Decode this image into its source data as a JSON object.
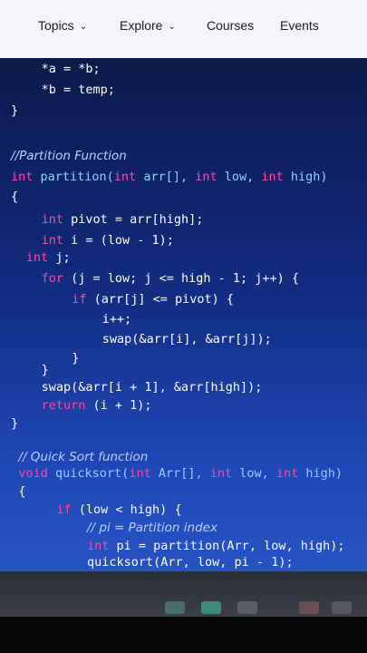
{
  "nav": {
    "items": [
      {
        "label": "Topics",
        "has_dropdown": true
      },
      {
        "label": "Explore",
        "has_dropdown": true
      },
      {
        "label": "Courses",
        "has_dropdown": false
      },
      {
        "label": "Events",
        "has_dropdown": false
      }
    ]
  },
  "code": {
    "lines": [
      {
        "indent": 4,
        "tokens": [
          {
            "t": "*a = *b;",
            "c": "pl"
          }
        ]
      },
      {
        "indent": 4,
        "tokens": [
          {
            "t": "*b = temp;",
            "c": "pl"
          }
        ]
      },
      {
        "indent": 0,
        "tokens": [
          {
            "t": "}",
            "c": "pl"
          }
        ]
      },
      {
        "indent": 0,
        "tokens": []
      },
      {
        "indent": 0,
        "tokens": [
          {
            "t": "//Partition Function",
            "c": "cm"
          }
        ]
      },
      {
        "indent": 0,
        "tokens": [
          {
            "t": "int ",
            "c": "kw"
          },
          {
            "t": "partition(",
            "c": "fn"
          },
          {
            "t": "int ",
            "c": "kw"
          },
          {
            "t": "arr[], ",
            "c": "fn"
          },
          {
            "t": "int ",
            "c": "kw"
          },
          {
            "t": "low, ",
            "c": "fn"
          },
          {
            "t": "int ",
            "c": "kw"
          },
          {
            "t": "high)",
            "c": "fn"
          }
        ]
      },
      {
        "indent": 0,
        "tokens": [
          {
            "t": "{",
            "c": "pl"
          }
        ]
      },
      {
        "indent": 4,
        "tokens": [
          {
            "t": "int ",
            "c": "kw"
          },
          {
            "t": "pivot = arr[high];",
            "c": "pl"
          }
        ]
      },
      {
        "indent": 4,
        "tokens": [
          {
            "t": "int ",
            "c": "kw"
          },
          {
            "t": "i = (low - 1);",
            "c": "pl"
          }
        ]
      },
      {
        "indent": 2,
        "tokens": [
          {
            "t": "int ",
            "c": "kw"
          },
          {
            "t": "j;",
            "c": "pl"
          }
        ]
      },
      {
        "indent": 4,
        "tokens": [
          {
            "t": "for ",
            "c": "kw"
          },
          {
            "t": "(j = low; j <= high - 1; j++) {",
            "c": "pl"
          }
        ]
      },
      {
        "indent": 8,
        "tokens": [
          {
            "t": "if ",
            "c": "kw"
          },
          {
            "t": "(arr[j] <= pivot) {",
            "c": "pl"
          }
        ]
      },
      {
        "indent": 12,
        "tokens": [
          {
            "t": "i++;",
            "c": "pl"
          }
        ]
      },
      {
        "indent": 12,
        "tokens": [
          {
            "t": "swap(&arr[i], &arr[j]);",
            "c": "pl"
          }
        ]
      },
      {
        "indent": 8,
        "tokens": [
          {
            "t": "}",
            "c": "pl"
          }
        ]
      },
      {
        "indent": 4,
        "tokens": [
          {
            "t": "}",
            "c": "pl"
          }
        ]
      },
      {
        "indent": 4,
        "tokens": [
          {
            "t": "swap(&arr[i + 1], &arr[high]);",
            "c": "pl"
          }
        ]
      },
      {
        "indent": 4,
        "tokens": [
          {
            "t": "return ",
            "c": "kw"
          },
          {
            "t": "(i + 1);",
            "c": "pl"
          }
        ]
      },
      {
        "indent": 0,
        "tokens": [
          {
            "t": "}",
            "c": "pl"
          }
        ]
      },
      {
        "indent": 0,
        "tokens": []
      },
      {
        "indent": 1,
        "tokens": [
          {
            "t": "// Quick Sort function",
            "c": "cm"
          }
        ]
      },
      {
        "indent": 1,
        "tokens": [
          {
            "t": "void ",
            "c": "kw"
          },
          {
            "t": "quicksort(",
            "c": "fn"
          },
          {
            "t": "int ",
            "c": "kw"
          },
          {
            "t": "Arr[], ",
            "c": "fn"
          },
          {
            "t": "int ",
            "c": "kw"
          },
          {
            "t": "low, ",
            "c": "fn"
          },
          {
            "t": "int ",
            "c": "kw"
          },
          {
            "t": "high)",
            "c": "fn"
          }
        ]
      },
      {
        "indent": 1,
        "tokens": [
          {
            "t": "{",
            "c": "pl"
          }
        ]
      },
      {
        "indent": 6,
        "tokens": [
          {
            "t": "if ",
            "c": "kw"
          },
          {
            "t": "(low < high) {",
            "c": "pl"
          }
        ]
      },
      {
        "indent": 10,
        "tokens": [
          {
            "t": "// pi = Partition index",
            "c": "cm"
          }
        ]
      },
      {
        "indent": 10,
        "tokens": [
          {
            "t": "int ",
            "c": "kw"
          },
          {
            "t": "pi = partition(Arr, low, high);",
            "c": "pl"
          }
        ]
      },
      {
        "indent": 10,
        "tokens": [
          {
            "t": "quicksort(Arr, low, pi - 1);",
            "c": "pl"
          }
        ]
      }
    ]
  },
  "colors": {
    "keyword": "#ff4aa2",
    "identifier": "#8fd4ff",
    "comment": "#bcd0ff",
    "plain": "#ffffff",
    "editor_top": "#0b1a4a",
    "editor_bottom": "#2653c4"
  },
  "taskbar": {
    "icons": [
      "app-icon",
      "browser-icon",
      "files-icon",
      "settings-icon",
      "store-icon"
    ]
  }
}
